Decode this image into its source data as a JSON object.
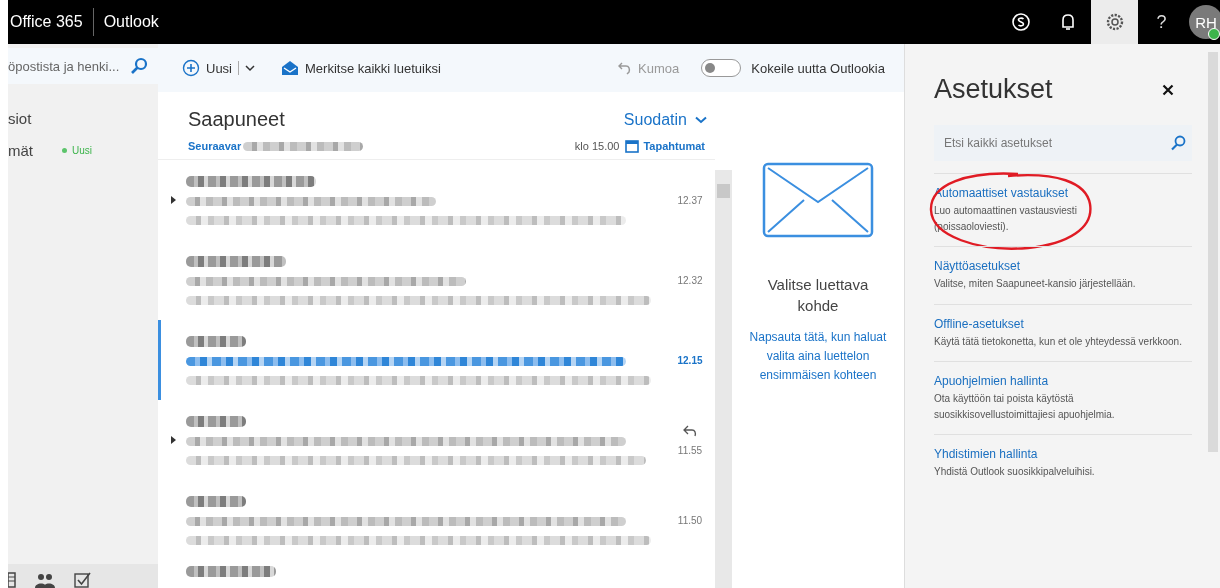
{
  "top_bar": {
    "suite": "Office 365",
    "app": "Outlook",
    "avatar": "RH",
    "help": "?",
    "settings_selected": true
  },
  "sidebar": {
    "search": {
      "placeholder": "öpostista ja henki..."
    },
    "folders": [
      {
        "label": "siot"
      },
      {
        "label": "mät",
        "badge": "Uusi"
      }
    ]
  },
  "toolbar": {
    "new": "Uusi",
    "mark_all_read": "Merkitse kaikki luetuiksi",
    "undo": {
      "label": "Kumoa",
      "disabled": true
    },
    "try_new": {
      "label": "Kokeile uutta Outlookia",
      "on": false
    }
  },
  "mail_list": {
    "title": "Saapuneet",
    "filter": "Suodatin",
    "next_label": "Seuraavar",
    "next_time": "klo 15.00",
    "events": "Tapahtumat",
    "rows": [
      {
        "time": "12.37",
        "selected": false,
        "expandable": true,
        "replied": false
      },
      {
        "time": "12.32",
        "selected": false,
        "expandable": false,
        "replied": false
      },
      {
        "time": "12.15",
        "selected": true,
        "expandable": false,
        "replied": false
      },
      {
        "time": "11.55",
        "selected": false,
        "expandable": true,
        "replied": true
      },
      {
        "time": "11.50",
        "selected": false,
        "expandable": false,
        "replied": false
      }
    ]
  },
  "reading_pane": {
    "title": "Valitse luettava kohde",
    "link": "Napsauta tätä, kun haluat valita aina luettelon ensimmäisen kohteen"
  },
  "settings": {
    "title": "Asetukset",
    "search": {
      "placeholder": "Etsi kaikki asetukset"
    },
    "items": [
      {
        "title": "Automaattiset vastaukset",
        "description": "Luo automaattinen vastausviesti (poissaoloviesti).",
        "circled": true
      },
      {
        "title": "Näyttöasetukset",
        "description": "Valitse, miten Saapuneet-kansio järjestellään.",
        "circled": false
      },
      {
        "title": "Offline-asetukset",
        "description": "Käytä tätä tietokonetta, kun et ole yhteydessä verkkoon.",
        "circled": false
      },
      {
        "title": "Apuohjelmien hallinta",
        "description": "Ota käyttöön tai poista käytöstä suosikkisovellustoimittajiesi apuohjelmia.",
        "circled": false
      },
      {
        "title": "Yhdistimien hallinta",
        "description": "Yhdistä Outlook suosikkipalveluihisi.",
        "circled": false
      }
    ]
  }
}
